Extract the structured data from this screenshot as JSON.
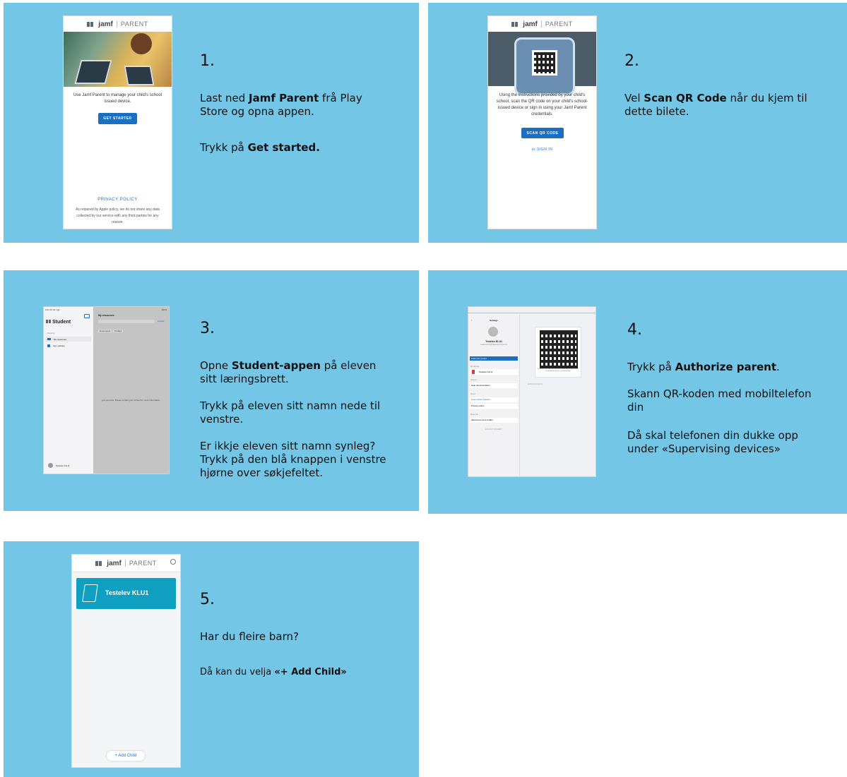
{
  "steps": [
    {
      "number": "1.",
      "para1": {
        "pre": "Last ned ",
        "bold": "Jamf Parent",
        "post": " frå Play Store og opna appen."
      },
      "para2": {
        "pre": "Trykk på ",
        "bold": "Get started."
      }
    },
    {
      "number": "2.",
      "para1": {
        "pre": "Vel ",
        "bold": "Scan QR Code",
        "post": " når du kjem til dette bilete."
      }
    },
    {
      "number": "3.",
      "para1": {
        "pre": "Opne ",
        "bold": "Student-appen",
        "post": " på eleven sitt læringsbrett."
      },
      "para2": "Trykk på eleven sitt namn nede til venstre.",
      "para3": "Er ikkje eleven sitt namn synleg? Trykk på den blå knappen i venstre hjørne over søkjefeltet."
    },
    {
      "number": "4.",
      "para1": {
        "pre": "Trykk på ",
        "bold": "Authorize parent",
        "post": "."
      },
      "para2": "Skann QR-koden med mobiltelefon din",
      "para3": "Då skal telefonen din dukke opp under «Supervising devices»"
    },
    {
      "number": "5.",
      "para1": "Har du fleire barn?",
      "para2": {
        "pre": "Då kan du velja ",
        "bold": "«+ Add Child»"
      }
    }
  ],
  "screen1": {
    "logo": "jamf",
    "parent": "PARENT",
    "desc": "Use Jamf Parent to manage your child's school issued device.",
    "button": "GET STARTED",
    "privacy_title": "PRIVACY POLICY",
    "privacy_text": "As required by Apple policy, we do not share any data collected by our service with any third parties for any reason."
  },
  "screen2": {
    "logo": "jamf",
    "parent": "PARENT",
    "desc": "Using the instructions provided by your child's school, scan the QR code on your child's school-issued device or sign in using your Jamf Parent credentials.",
    "button": "SCAN QR CODE",
    "signin": "or SIGN IN"
  },
  "screen3": {
    "status": "9:41 Fri 24. Apr",
    "battery": "100%",
    "title": "Student",
    "section": "Viewing",
    "item1": "My resources",
    "item2": "App updates",
    "main_title": "My resources",
    "cancel": "Cancel",
    "tab1": "Documents",
    "tab2": "Profiles",
    "message": "your account. Please contact your school for more information.",
    "user": "Testelev KLU1"
  },
  "screen4": {
    "settings": "Settings",
    "name": "Testelev KLU1",
    "email": "testelev.klu1@skole.kommune.no",
    "authorize": "Authorize parent",
    "device_label": "My devices",
    "device": "Testelev KLU1",
    "support": "Support",
    "help": "Help documentation",
    "about": "About",
    "tour": "Learn about Student",
    "privacy": "Privacy policy",
    "school": "Skole info",
    "school_item": "Skuld kommune Iedder",
    "logout": "LOG OUT STUDENT",
    "qr_caption": "Scan this QR code with the Jamf Parent app on your phone to add this device as a parent device",
    "auth_label": "Authorized parents"
  },
  "screen5": {
    "logo": "jamf",
    "parent": "PARENT",
    "child": "Testelev KLU1",
    "add": "+ Add Child"
  },
  "colors": {
    "panel": "#74c6e6",
    "button": "#1a6fc2",
    "child_card": "#0f9fc1"
  }
}
